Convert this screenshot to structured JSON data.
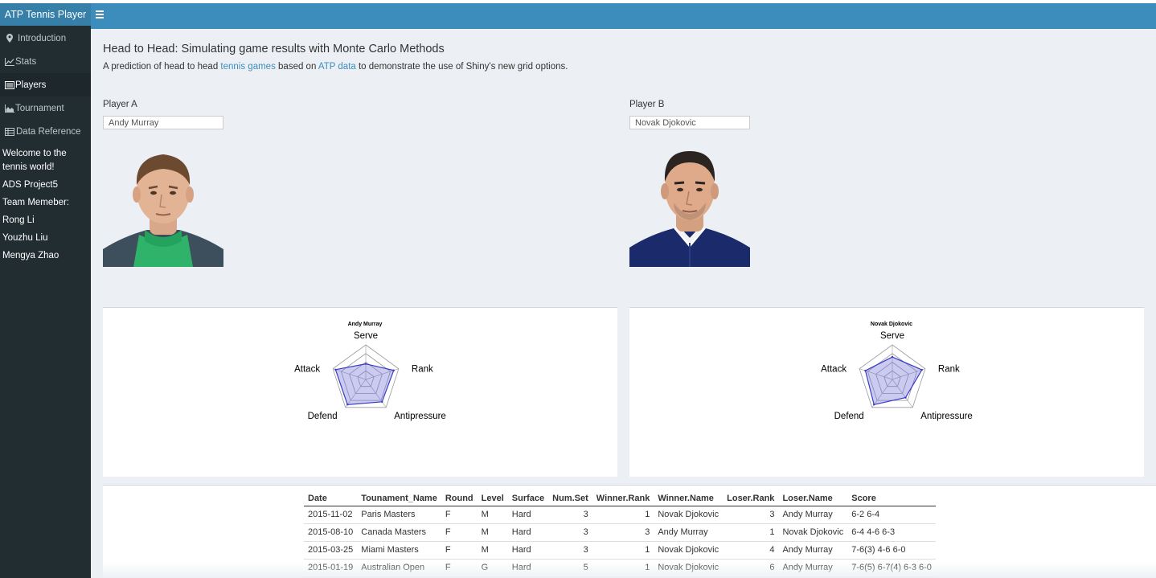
{
  "app": {
    "title": "ATP Tennis Player"
  },
  "sidebar": {
    "items": [
      {
        "label": "Introduction",
        "icon": "map-marker-icon"
      },
      {
        "label": "Stats",
        "icon": "line-chart-icon"
      },
      {
        "label": "Players",
        "icon": "list-alt-icon",
        "active": true
      },
      {
        "label": "Tournament",
        "icon": "area-chart-icon"
      },
      {
        "label": "Data Reference",
        "icon": "table-icon"
      }
    ],
    "welcome": "Welcome to the tennis world!",
    "project": "ADS Project5",
    "team_label": "Team Memeber:",
    "members": [
      "Rong Li",
      "Youzhu Liu",
      "Mengya Zhao"
    ]
  },
  "main": {
    "title": "Head to Head: Simulating game results with Monte Carlo Methods",
    "subtitle": {
      "part1": "A prediction of head to head ",
      "link1": "tennis games",
      "part2": " based on ",
      "link2": "ATP data",
      "part3": " to demonstrate the use of Shiny's new grid options."
    },
    "player_a": {
      "label": "Player A",
      "value": "Andy Murray"
    },
    "player_b": {
      "label": "Player B",
      "value": "Novak Djokovic"
    }
  },
  "chart_data": [
    {
      "type": "radar",
      "title": "Andy Murray",
      "axes": [
        "Serve",
        "Rank",
        "Antipressure",
        "Defend",
        "Attack"
      ],
      "values": [
        0.45,
        0.85,
        0.8,
        0.9,
        0.92
      ],
      "max": 1,
      "levels": 4
    },
    {
      "type": "radar",
      "title": "Novak Djokovic",
      "axes": [
        "Serve",
        "Rank",
        "Antipressure",
        "Defend",
        "Attack"
      ],
      "values": [
        0.65,
        0.9,
        0.65,
        0.9,
        0.82
      ],
      "max": 1,
      "levels": 4
    }
  ],
  "table": {
    "columns": [
      "Date",
      "Tounament_Name",
      "Round",
      "Level",
      "Surface",
      "Num.Set",
      "Winner.Rank",
      "Winner.Name",
      "Loser.Rank",
      "Loser.Name",
      "Score"
    ],
    "rows": [
      [
        "2015-11-02",
        "Paris Masters",
        "F",
        "M",
        "Hard",
        "3",
        "1",
        "Novak Djokovic",
        "3",
        "Andy Murray",
        "6-2 6-4"
      ],
      [
        "2015-08-10",
        "Canada Masters",
        "F",
        "M",
        "Hard",
        "3",
        "3",
        "Andy Murray",
        "1",
        "Novak Djokovic",
        "6-4 4-6 6-3"
      ],
      [
        "2015-03-25",
        "Miami Masters",
        "F",
        "M",
        "Hard",
        "3",
        "1",
        "Novak Djokovic",
        "4",
        "Andy Murray",
        "7-6(3) 4-6 6-0"
      ],
      [
        "2015-01-19",
        "Australian Open",
        "F",
        "G",
        "Hard",
        "5",
        "1",
        "Novak Djokovic",
        "6",
        "Andy Murray",
        "7-6(5) 6-7(4) 6-3 6-0"
      ]
    ]
  },
  "colors": {
    "header": "#3c8dbc",
    "logo": "#367fa9",
    "sidebar": "#222d32",
    "sidebar_active": "#1e282c",
    "radar_fill": "#6b6bd6",
    "radar_stroke": "#3a3ac8"
  }
}
